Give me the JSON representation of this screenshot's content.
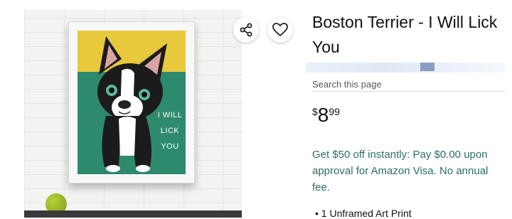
{
  "product": {
    "title": "Boston Terrier - I Will Lick You",
    "search_link": "Search this page",
    "price": {
      "symbol": "$",
      "whole": "8",
      "fraction": "99"
    },
    "promo": "Get $50 off instantly: Pay $0.00 upon approval for Amazon Visa. No annual fee.",
    "bullets": [
      "1 Unframed Art Print"
    ]
  },
  "image": {
    "poster_text_line1": "I WILL",
    "poster_text_line2": "LICK YOU"
  },
  "actions": {
    "share_icon": "share-icon",
    "wishlist_icon": "heart-icon"
  },
  "colors": {
    "promo_text": "#2b6e6a",
    "poster_yellow": "#e8c93c",
    "poster_green": "#2e8a6e"
  }
}
